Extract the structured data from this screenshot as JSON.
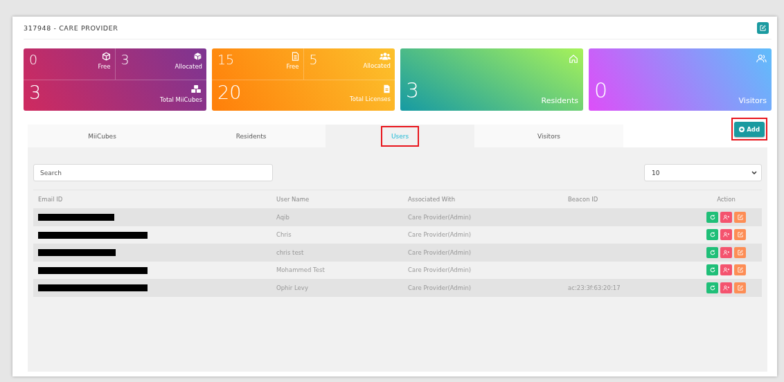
{
  "header": {
    "title": "317948 - CARE PROVIDER"
  },
  "cards": [
    {
      "kind": "split",
      "top": [
        {
          "value": "0",
          "label": "Free"
        },
        {
          "value": "3",
          "label": "Allocated"
        }
      ],
      "bottom": {
        "value": "3",
        "label": "Total MiiCubes"
      }
    },
    {
      "kind": "split",
      "top": [
        {
          "value": "15",
          "label": "Free"
        },
        {
          "value": "5",
          "label": "Allocated"
        }
      ],
      "bottom": {
        "value": "20",
        "label": "Total Licenses"
      }
    },
    {
      "kind": "single",
      "value": "3",
      "label": "Residents"
    },
    {
      "kind": "single",
      "value": "0",
      "label": "Visitors"
    }
  ],
  "tabs": [
    {
      "label": "MiiCubes",
      "selected": false,
      "highlighted": false
    },
    {
      "label": "Residents",
      "selected": false,
      "highlighted": false
    },
    {
      "label": "Users",
      "selected": true,
      "highlighted": true
    },
    {
      "label": "Visitors",
      "selected": false,
      "highlighted": false
    }
  ],
  "add_button": {
    "label": "Add",
    "highlighted": true
  },
  "search": {
    "placeholder": "Search"
  },
  "page_size": {
    "value": "10"
  },
  "table": {
    "columns": [
      "Email ID",
      "User Name",
      "Associated With",
      "Beacon ID",
      "Action"
    ],
    "rows": [
      {
        "email_redacted": true,
        "user_name": "Aqib",
        "associated_with": "Care Provider(Admin)"
      },
      {
        "email_redacted": true,
        "user_name": "Chris",
        "associated_with": "Care Provider(Admin)"
      },
      {
        "email_redacted": true,
        "user_name": "chris test",
        "associated_with": "Care Provider(Admin)"
      },
      {
        "email_redacted": true,
        "user_name": "Mohammed Test",
        "associated_with": "Care Provider(Admin)"
      },
      {
        "email_redacted": true,
        "user_name": "Ophir Levy",
        "associated_with": "Care Provider(Admin)",
        "beacon_id": "ac:23:3f:63:20:17"
      }
    ]
  }
}
